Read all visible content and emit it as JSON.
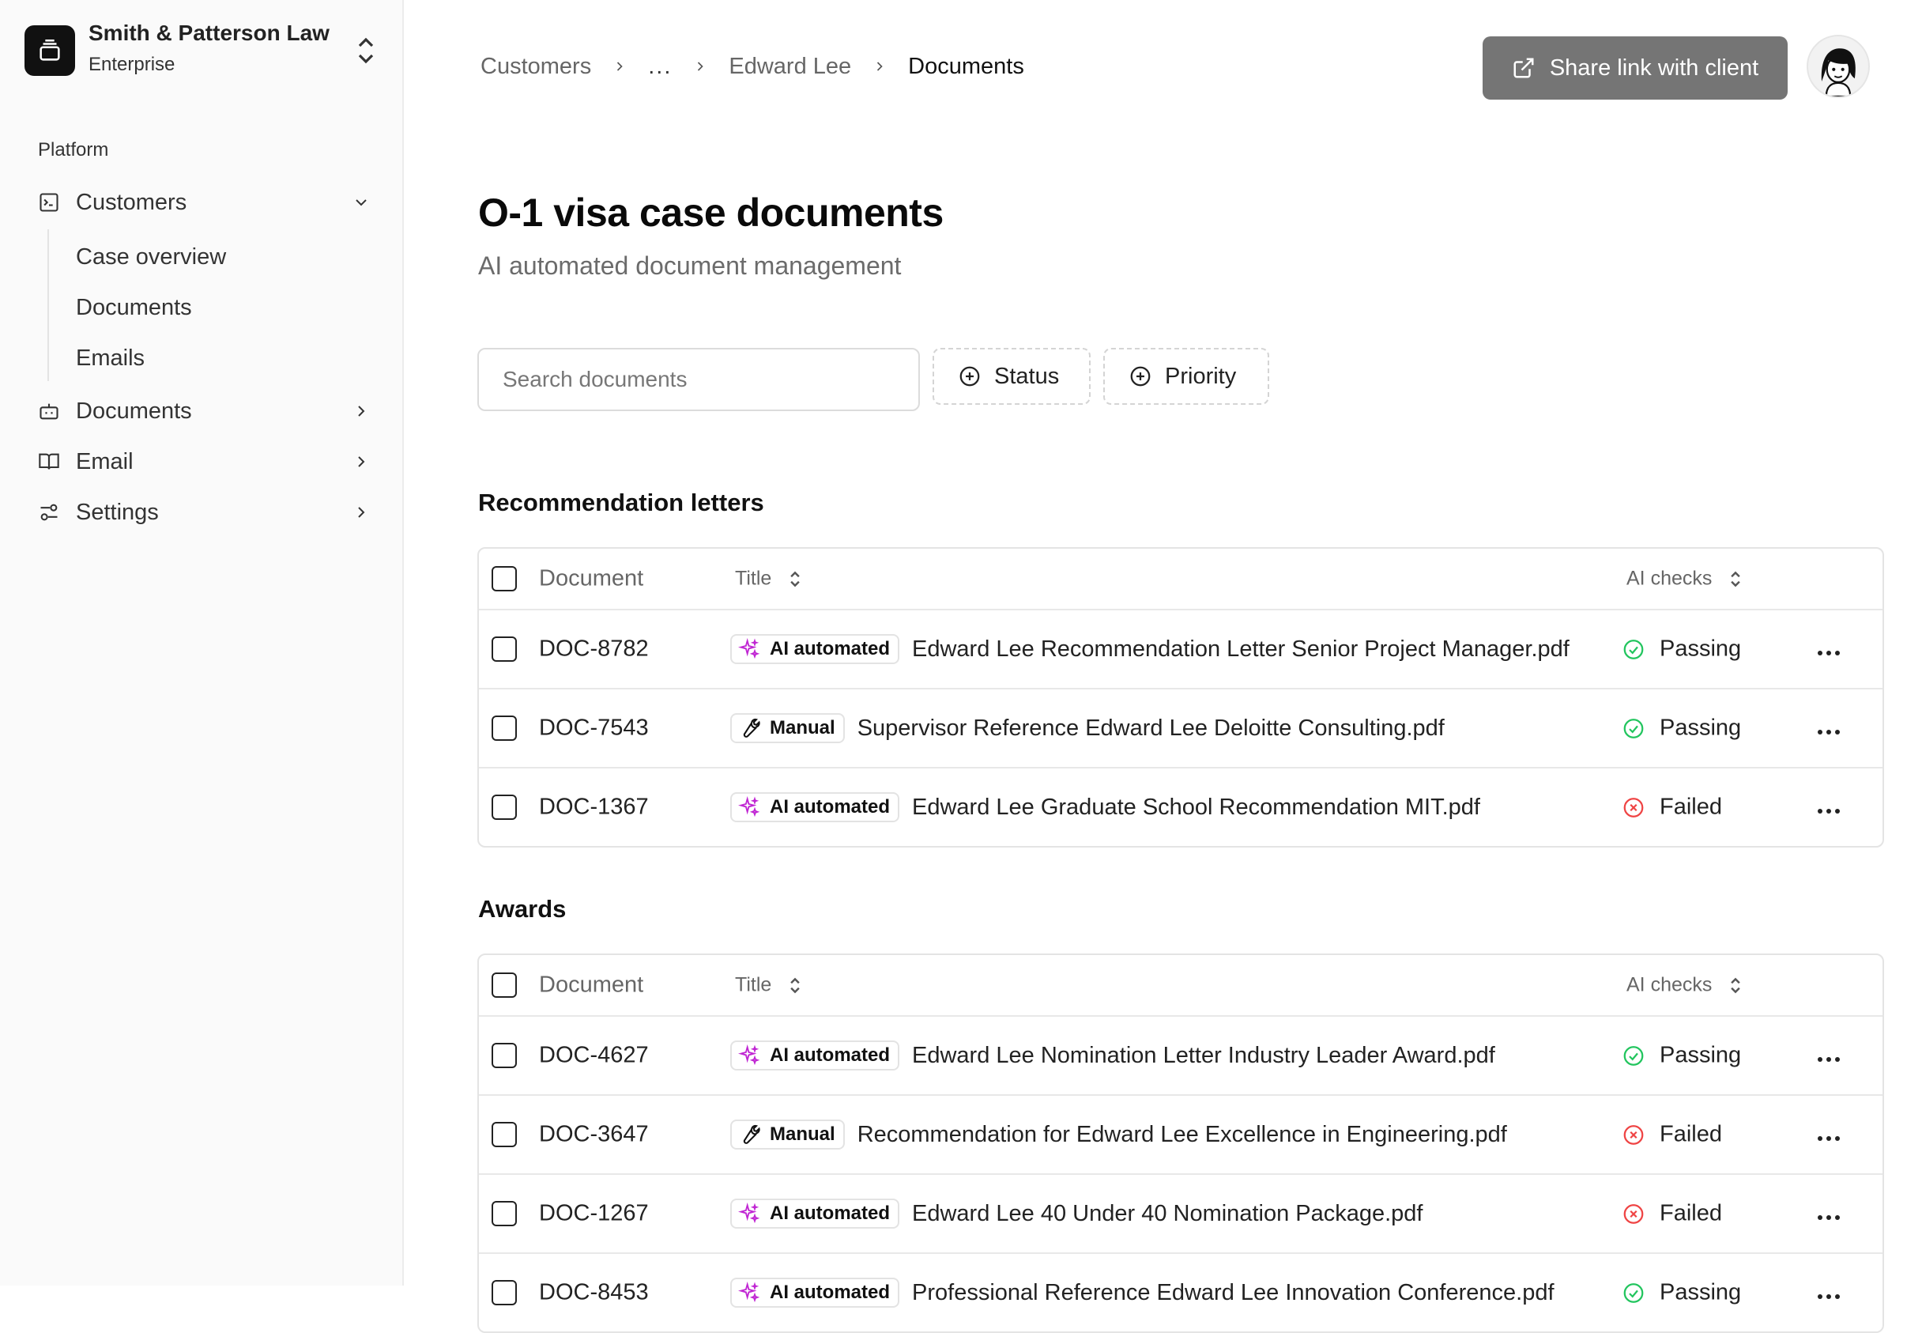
{
  "org": {
    "name": "Smith & Patterson Law",
    "plan": "Enterprise"
  },
  "sidebar": {
    "group_label": "Platform",
    "items": [
      {
        "label": "Customers",
        "icon": "terminal-icon",
        "expanded": true
      },
      {
        "label": "Documents",
        "icon": "bot-icon",
        "expanded": false
      },
      {
        "label": "Email",
        "icon": "book-icon",
        "expanded": false
      },
      {
        "label": "Settings",
        "icon": "sliders-icon",
        "expanded": false
      }
    ],
    "sub_items": [
      "Case overview",
      "Documents",
      "Emails"
    ]
  },
  "breadcrumb": {
    "items": [
      "Customers",
      "...",
      "Edward Lee",
      "Documents"
    ]
  },
  "header": {
    "share_label": "Share link with client"
  },
  "page": {
    "title": "O-1 visa case documents",
    "subtitle": "AI automated document management"
  },
  "filters": {
    "search_placeholder": "Search documents",
    "status_label": "Status",
    "priority_label": "Priority"
  },
  "table_headers": {
    "document": "Document",
    "title": "Title",
    "ai_checks": "AI checks"
  },
  "sections": [
    {
      "title": "Recommendation letters",
      "rows": [
        {
          "id": "DOC-8782",
          "type": "AI automated",
          "title": "Edward Lee Recommendation Letter Senior Project Manager.pdf",
          "status": "Passing"
        },
        {
          "id": "DOC-7543",
          "type": "Manual",
          "title": "Supervisor Reference Edward Lee Deloitte Consulting.pdf",
          "status": "Passing"
        },
        {
          "id": "DOC-1367",
          "type": "AI automated",
          "title": "Edward Lee Graduate School Recommendation MIT.pdf",
          "status": "Failed"
        }
      ]
    },
    {
      "title": "Awards",
      "rows": [
        {
          "id": "DOC-4627",
          "type": "AI automated",
          "title": "Edward Lee Nomination Letter Industry Leader Award.pdf",
          "status": "Passing"
        },
        {
          "id": "DOC-3647",
          "type": "Manual",
          "title": "Recommendation for Edward Lee Excellence in Engineering.pdf",
          "status": "Failed"
        },
        {
          "id": "DOC-1267",
          "type": "AI automated",
          "title": "Edward Lee 40 Under 40 Nomination Package.pdf",
          "status": "Failed"
        },
        {
          "id": "DOC-8453",
          "type": "AI automated",
          "title": "Professional Reference Edward Lee Innovation Conference.pdf",
          "status": "Passing"
        }
      ]
    }
  ],
  "colors": {
    "passing": "#22c55e",
    "failed": "#ef4444",
    "ai_icon": "#c026d3",
    "share_button": "#757575"
  }
}
